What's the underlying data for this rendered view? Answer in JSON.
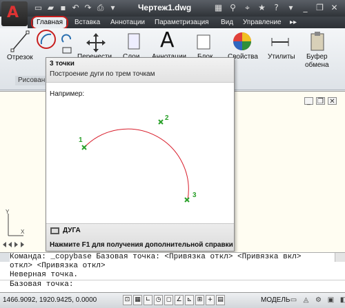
{
  "title": "Чертеж1.dwg",
  "tabs": [
    "Главная",
    "Вставка",
    "Аннотации",
    "Параметризация",
    "Вид",
    "Управление"
  ],
  "tabs_more": "▸▸",
  "ribbon": {
    "line": "Отрезок",
    "move": "Перенести",
    "layers": "Слои",
    "annot": "Аннотации",
    "block": "Блок",
    "props": "Свойства",
    "utils": "Утилиты",
    "clipboard_1": "Буфер",
    "clipboard_2": "обмена",
    "panel": "Рисован"
  },
  "tooltip": {
    "title": "3 точки",
    "desc": "Построение дуги по трем точкам",
    "example": "Например:",
    "p1": "1",
    "p2": "2",
    "p3": "3",
    "command": "ДУГА",
    "help": "Нажмите F1 для получения дополнительной справки"
  },
  "ucs": {
    "y": "Y",
    "x": "X"
  },
  "cmdline": [
    "Команда: _copybase Базовая точка:  <Привязка откл>  <Привязка вкл>",
    "откл>  <Привязка откл>",
    "Неверная точка.",
    "Базовая точка:"
  ],
  "status": {
    "coords": "1466.9092, 1920.9425, 0.0000",
    "model": "МОДЕЛЬ"
  },
  "colors": {
    "accent": "#c81e1e",
    "arc": "#d81c2a",
    "point": "#2aa02a"
  }
}
